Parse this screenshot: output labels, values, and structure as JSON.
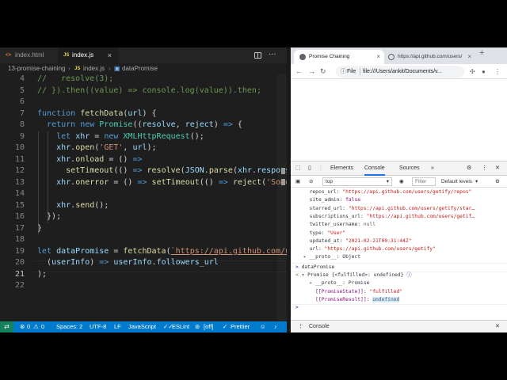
{
  "editor": {
    "tabs": [
      {
        "type": "<>",
        "label": "index.html"
      },
      {
        "type": "JS",
        "label": "index.js"
      }
    ],
    "breadcrumb": [
      "13-promise-chaining",
      "JS",
      "index.js",
      "dataPromise"
    ],
    "lines": [
      {
        "n": "4",
        "tokens": [
          [
            "cm",
            "//   resolve(3);"
          ]
        ]
      },
      {
        "n": "5",
        "tokens": [
          [
            "cm",
            "// }).then((value) => console.log(value)).then;"
          ]
        ]
      },
      {
        "n": "6",
        "tokens": []
      },
      {
        "n": "7",
        "tokens": [
          [
            "kw",
            "function "
          ],
          [
            "fn",
            "fetchData"
          ],
          [
            "pl",
            "("
          ],
          [
            "vr",
            "url"
          ],
          [
            "pl",
            ") {"
          ]
        ]
      },
      {
        "n": "8",
        "tokens": [
          [
            "pl",
            "  "
          ],
          [
            "kw",
            "return new "
          ],
          [
            "cls",
            "Promise"
          ],
          [
            "pl",
            "(("
          ],
          [
            "vr",
            "resolve"
          ],
          [
            "pl",
            ", "
          ],
          [
            "vr",
            "reject"
          ],
          [
            "pl",
            ") "
          ],
          [
            "kw",
            "=>"
          ],
          [
            "pl",
            " {"
          ]
        ]
      },
      {
        "n": "9",
        "tokens": [
          [
            "pl",
            "    "
          ],
          [
            "kw",
            "let "
          ],
          [
            "vr",
            "xhr"
          ],
          [
            "pl",
            " = "
          ],
          [
            "kw",
            "new "
          ],
          [
            "cls",
            "XMLHttpRequest"
          ],
          [
            "pl",
            "();"
          ]
        ]
      },
      {
        "n": "10",
        "tokens": [
          [
            "pl",
            "    "
          ],
          [
            "vr",
            "xhr"
          ],
          [
            "pl",
            "."
          ],
          [
            "fn",
            "open"
          ],
          [
            "pl",
            "("
          ],
          [
            "str",
            "'GET'"
          ],
          [
            "pl",
            ", "
          ],
          [
            "vr",
            "url"
          ],
          [
            "pl",
            ");"
          ]
        ]
      },
      {
        "n": "11",
        "tokens": [
          [
            "pl",
            "    "
          ],
          [
            "vr",
            "xhr"
          ],
          [
            "pl",
            "."
          ],
          [
            "fn",
            "onload"
          ],
          [
            "pl",
            " = () "
          ],
          [
            "kw",
            "=>"
          ]
        ]
      },
      {
        "n": "12",
        "tokens": [
          [
            "pl",
            "      "
          ],
          [
            "fn",
            "setTimeout"
          ],
          [
            "pl",
            "(() "
          ],
          [
            "kw",
            "=>"
          ],
          [
            "pl",
            " "
          ],
          [
            "fn",
            "resolve"
          ],
          [
            "pl",
            "("
          ],
          [
            "vr",
            "JSON"
          ],
          [
            "pl",
            "."
          ],
          [
            "fn",
            "parse"
          ],
          [
            "pl",
            "("
          ],
          [
            "vr",
            "xhr"
          ],
          [
            "pl",
            "."
          ],
          [
            "vr",
            "response"
          ]
        ]
      },
      {
        "n": "13",
        "tokens": [
          [
            "pl",
            "    "
          ],
          [
            "vr",
            "xhr"
          ],
          [
            "pl",
            "."
          ],
          [
            "fn",
            "onerror"
          ],
          [
            "pl",
            " = () "
          ],
          [
            "kw",
            "=>"
          ],
          [
            "pl",
            " "
          ],
          [
            "fn",
            "setTimeout"
          ],
          [
            "pl",
            "(() "
          ],
          [
            "kw",
            "=>"
          ],
          [
            "pl",
            " "
          ],
          [
            "fn",
            "reject"
          ],
          [
            "pl",
            "("
          ],
          [
            "str",
            "'Somet"
          ]
        ]
      },
      {
        "n": "14",
        "tokens": []
      },
      {
        "n": "15",
        "tokens": [
          [
            "pl",
            "    "
          ],
          [
            "vr",
            "xhr"
          ],
          [
            "pl",
            "."
          ],
          [
            "fn",
            "send"
          ],
          [
            "pl",
            "();"
          ]
        ]
      },
      {
        "n": "16",
        "tokens": [
          [
            "pl",
            "  });"
          ]
        ]
      },
      {
        "n": "17",
        "tokens": [
          [
            "pl",
            "}"
          ]
        ]
      },
      {
        "n": "18",
        "tokens": []
      },
      {
        "n": "19",
        "tokens": [
          [
            "kw",
            "let "
          ],
          [
            "vr",
            "dataPromise"
          ],
          [
            "pl",
            " = "
          ],
          [
            "fn",
            "fetchData"
          ],
          [
            "pl",
            "("
          ],
          [
            "url",
            "`https://api.github.com/use"
          ]
        ]
      },
      {
        "n": "20",
        "tokens": [
          [
            "pl",
            "  ("
          ],
          [
            "vr",
            "userInfo"
          ],
          [
            "pl",
            ") "
          ],
          [
            "kw",
            "=>"
          ],
          [
            "pl",
            " "
          ],
          [
            "vr",
            "userInfo"
          ],
          [
            "pl",
            "."
          ],
          [
            "vr",
            "followers_url"
          ]
        ]
      },
      {
        "n": "21",
        "tokens": [
          [
            "pl",
            ");"
          ]
        ]
      },
      {
        "n": "22",
        "tokens": []
      }
    ],
    "current_line": "21",
    "status": {
      "errors": "0",
      "warnings": "0",
      "spaces": "Spaces: 2",
      "encoding": "UTF-8",
      "eol": "LF",
      "language": "JavaScript",
      "eslint": "ESLint",
      "off": "[off]",
      "prettier": "Prettier"
    }
  },
  "browser": {
    "tabs": [
      {
        "label": "Promise Chaining"
      },
      {
        "label": "https://api.github.com/users/"
      }
    ],
    "address": {
      "scheme": "File",
      "url": "file:///Users/ankit/Documents/v..."
    },
    "devtools": {
      "tabs": [
        "Elements",
        "Console",
        "Sources"
      ],
      "context": "top",
      "filter_placeholder": "Filter",
      "levels": "Default levels"
    },
    "console": [
      {
        "indent": 2,
        "parts": [
          [
            "cb",
            "  repos_url: "
          ],
          [
            "cs",
            "\"https://api.github.com/users/getify/repos\""
          ]
        ]
      },
      {
        "indent": 2,
        "parts": [
          [
            "cb",
            "  site_admin: "
          ],
          [
            "ck",
            "false"
          ]
        ]
      },
      {
        "indent": 2,
        "parts": [
          [
            "cb",
            "  starred_url: "
          ],
          [
            "cs",
            "\"https://api.github.com/users/getify/star…"
          ]
        ]
      },
      {
        "indent": 2,
        "parts": [
          [
            "cb",
            "  subscriptions_url: "
          ],
          [
            "cs",
            "\"https://api.github.com/users/getif…"
          ]
        ]
      },
      {
        "indent": 2,
        "parts": [
          [
            "cb",
            "  twitter_username: "
          ],
          [
            "cg",
            "null"
          ]
        ]
      },
      {
        "indent": 2,
        "parts": [
          [
            "cb",
            "  type: "
          ],
          [
            "cs",
            "\"User\""
          ]
        ]
      },
      {
        "indent": 2,
        "parts": [
          [
            "cb",
            "  updated_at: "
          ],
          [
            "cs",
            "\"2021-02-21T00:31:44Z\""
          ]
        ]
      },
      {
        "indent": 2,
        "parts": [
          [
            "cb",
            "  url: "
          ],
          [
            "cs",
            "\"https://api.github.com/users/getify\""
          ]
        ]
      },
      {
        "indent": 2,
        "parts": [
          [
            "cg",
            "▸ "
          ],
          [
            "cb",
            "__proto__: Object"
          ]
        ]
      },
      {
        "indent": 0,
        "parts": [
          [
            "cn",
            "> "
          ],
          [
            "cb",
            "dataPromise"
          ]
        ]
      },
      {
        "indent": 0,
        "parts": [
          [
            "cg",
            "< ▾ "
          ],
          [
            "cb",
            "Promise {<fulfilled>: undefined} "
          ],
          [
            "cn",
            "ⓘ"
          ]
        ]
      },
      {
        "indent": 2,
        "parts": [
          [
            "cg",
            "  ▸ "
          ],
          [
            "cb",
            "__proto__: Promise"
          ]
        ]
      },
      {
        "indent": 2,
        "parts": [
          [
            "cb",
            "    "
          ],
          [
            "ck",
            "[[PromiseState]]"
          ],
          [
            "cb",
            ": "
          ],
          [
            "cs",
            "\"fulfilled\""
          ]
        ]
      },
      {
        "indent": 2,
        "parts": [
          [
            "cb",
            "    "
          ],
          [
            "ck",
            "[[PromiseResult]]"
          ],
          [
            "cb",
            ": "
          ],
          [
            "cg",
            "undefined"
          ]
        ]
      },
      {
        "indent": 0,
        "parts": [
          [
            "cn",
            "> "
          ]
        ]
      }
    ],
    "drawer_label": "Console"
  }
}
